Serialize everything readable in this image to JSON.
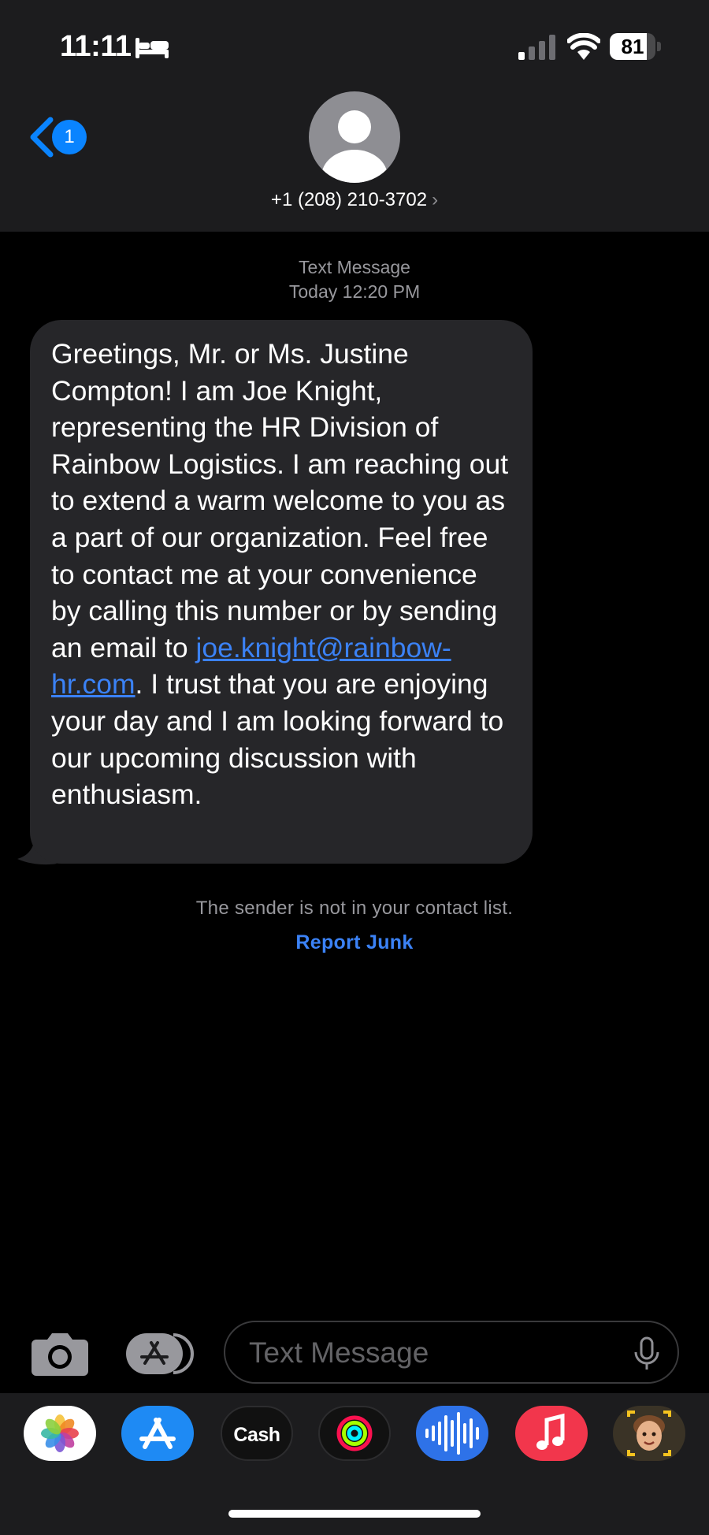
{
  "status_bar": {
    "time": "11:11",
    "battery": "81",
    "battery_level": 0.81
  },
  "header": {
    "back_badge_count": "1",
    "contact": "+1 (208) 210-3702",
    "chevron": "›"
  },
  "conversation": {
    "message_type": "Text Message",
    "timestamp": "Today 12:20 PM",
    "message": {
      "text_before_link": "Greetings, Mr. or Ms. Justine Compton! I am Joe Knight, representing the HR Division of Rainbow Logistics. I am reaching out to extend a warm welcome to you as a part of our organization. Feel free to contact me at your convenience by calling this number or by sending an email to ",
      "link": "joe.knight@rainbow-hr.com",
      "text_after_link": ". I trust that you are enjoying your day and I am looking forward to our upcoming discussion with enthusiasm."
    },
    "sender_warning": "The sender is not in your contact list.",
    "report_junk": "Report Junk"
  },
  "composer": {
    "placeholder": "Text Message"
  },
  "app_drawer": {
    "cash_label": "Cash",
    "cash_logo": "",
    "apps": [
      "photos-icon",
      "app-store-icon",
      "apple-cash-icon",
      "fitness-icon",
      "audio-icon",
      "music-icon",
      "memoji-icon"
    ]
  },
  "colors": {
    "accent": "#0a84ff",
    "link": "#3b82f6",
    "bubble": "#262629",
    "header": "#1c1c1e"
  }
}
